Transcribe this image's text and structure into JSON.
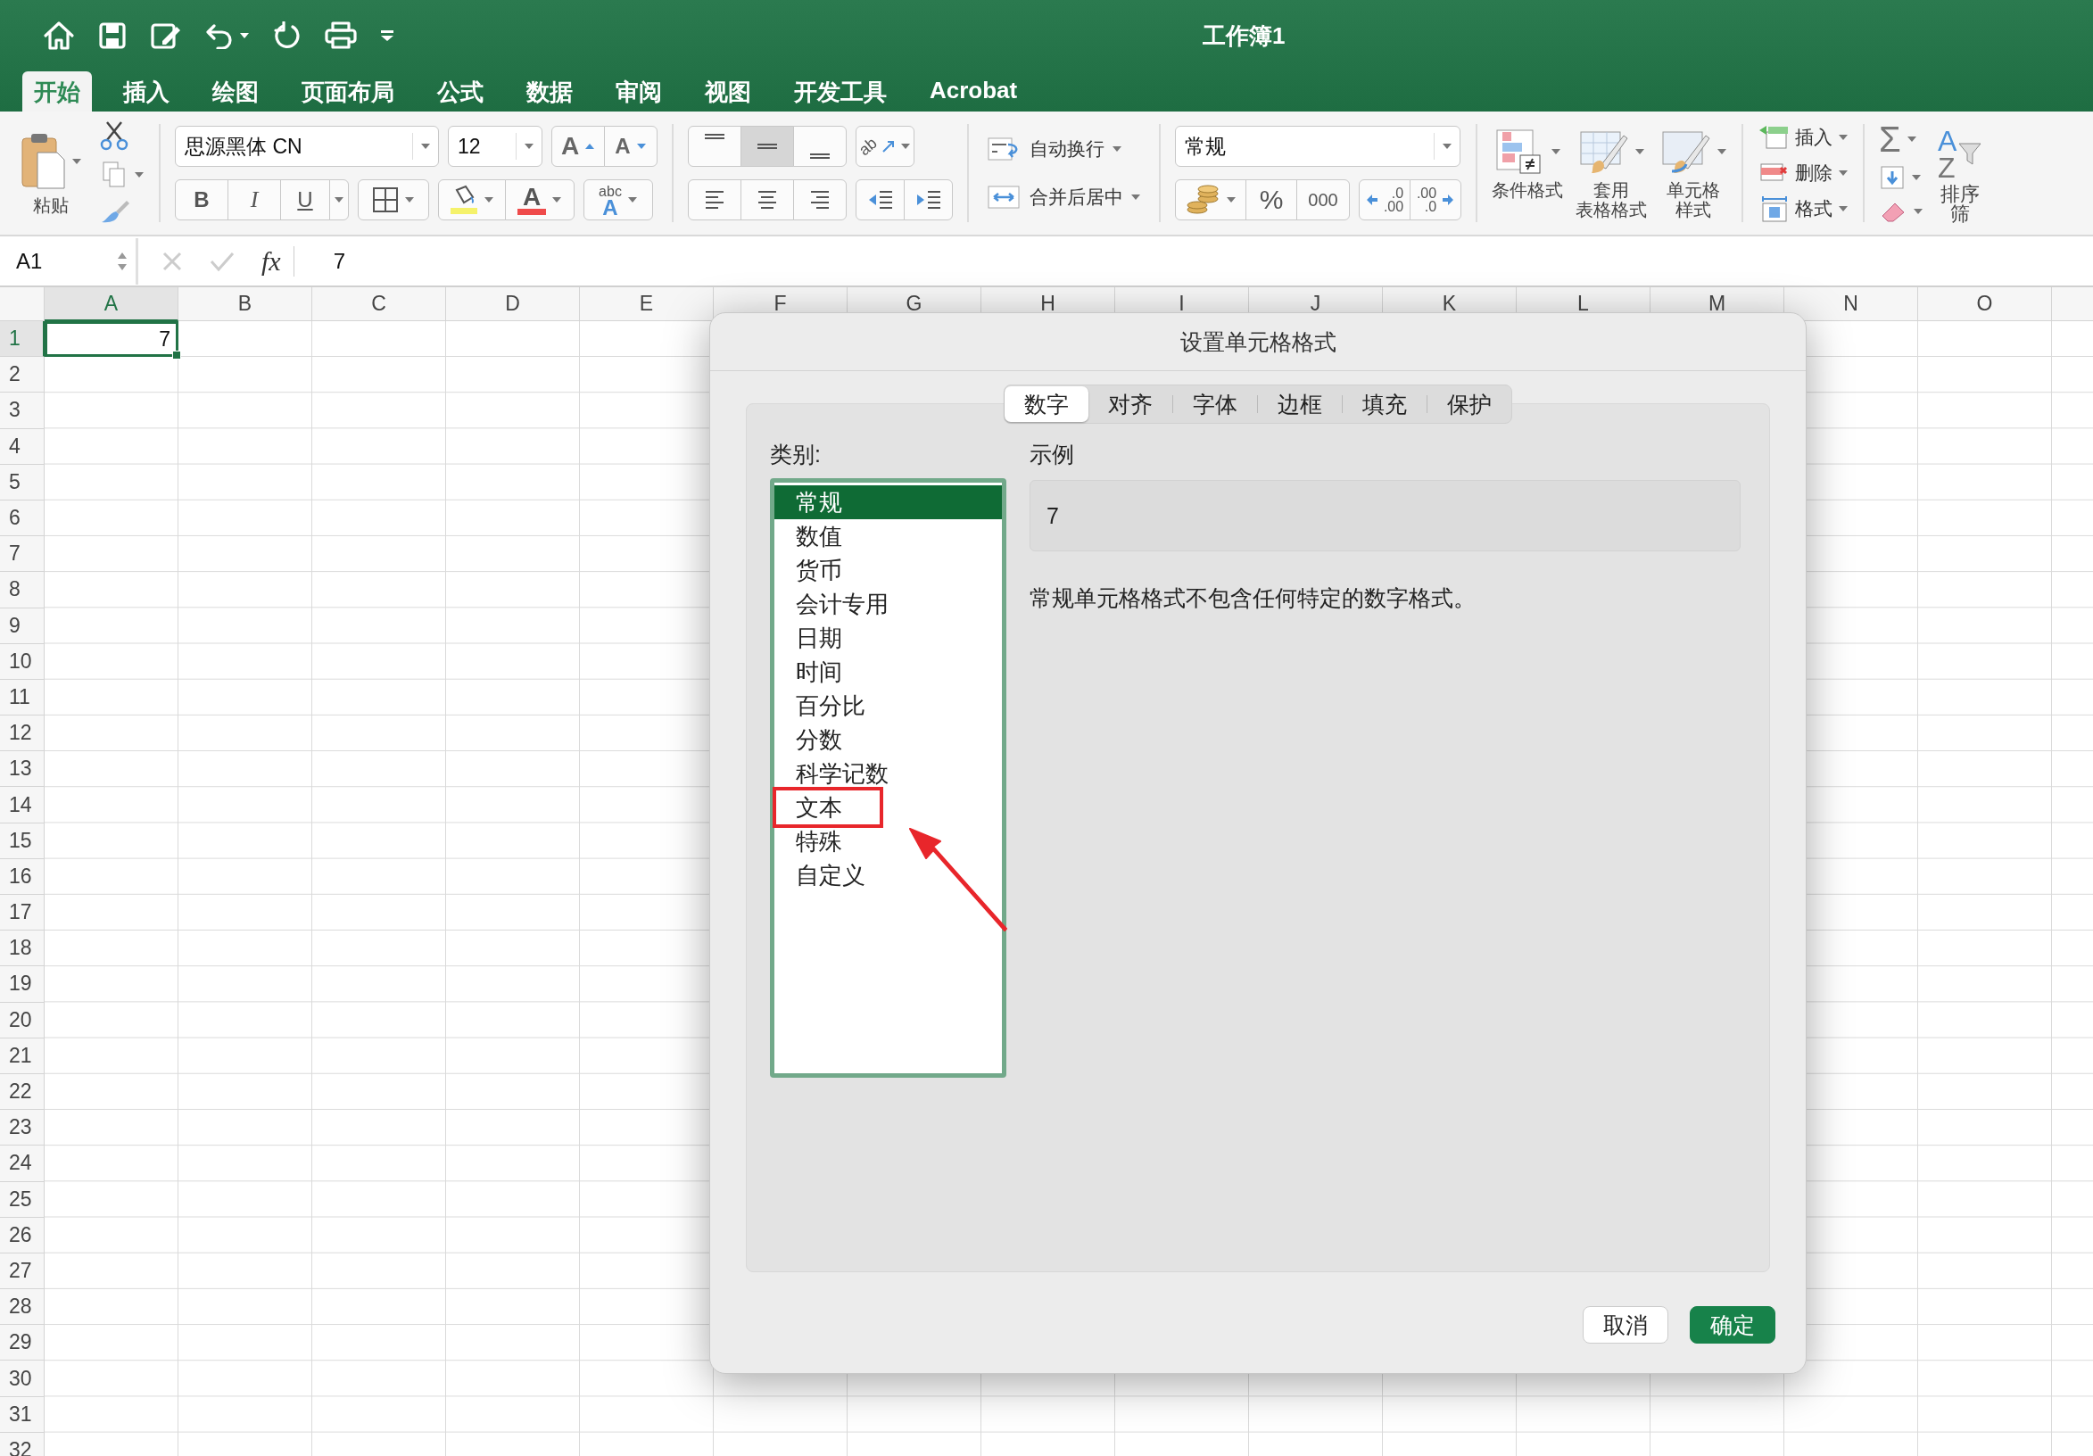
{
  "window": {
    "title": "工作簿1"
  },
  "ribbon_tabs": [
    {
      "label": "开始",
      "selected": true
    },
    {
      "label": "插入",
      "selected": false
    },
    {
      "label": "绘图",
      "selected": false
    },
    {
      "label": "页面布局",
      "selected": false
    },
    {
      "label": "公式",
      "selected": false
    },
    {
      "label": "数据",
      "selected": false
    },
    {
      "label": "审阅",
      "selected": false
    },
    {
      "label": "视图",
      "selected": false
    },
    {
      "label": "开发工具",
      "selected": false
    },
    {
      "label": "Acrobat",
      "selected": false
    }
  ],
  "ribbon": {
    "paste": "粘贴",
    "font_name": "思源黑体 CN",
    "font_size": "12",
    "grow_font": "A",
    "shrink_font": "A",
    "bold": "B",
    "italic": "I",
    "underline": "U",
    "font_color": "A",
    "phonetic": [
      "abc",
      "A"
    ],
    "vertical_alignment": [
      {
        "selected": false
      },
      {
        "selected": true
      },
      {
        "selected": false
      }
    ],
    "orientation": "ab",
    "wrap_text": "自动换行",
    "merge_center": "合并后居中",
    "number_format": "常规",
    "percent": "%",
    "thousands": "000",
    "decimal_increase": [
      ".0",
      ".00"
    ],
    "decimal_decrease": [
      ".00",
      ".0"
    ],
    "styles": [
      {
        "lines": [
          "条件格式"
        ]
      },
      {
        "lines": [
          "套用",
          "表格格式"
        ]
      },
      {
        "lines": [
          "单元格",
          "样式"
        ]
      }
    ],
    "cells": [
      "插入",
      "删除",
      "格式"
    ],
    "autosum": "Σ",
    "sort_letters": [
      "A",
      "Z"
    ],
    "sort_filter": [
      "排序",
      "筛"
    ]
  },
  "formula_bar": {
    "name_box": "A1",
    "fx": "fx",
    "value": "7"
  },
  "sheet": {
    "columns": [
      "A",
      "B",
      "C",
      "D",
      "E",
      "F",
      "G",
      "H",
      "I",
      "J",
      "K",
      "L",
      "M",
      "N",
      "O"
    ],
    "rows": [
      {
        "header": "1",
        "cells": [
          {
            "value": "7",
            "selected": true
          }
        ]
      },
      {
        "header": "2"
      },
      {
        "header": "3"
      },
      {
        "header": "4"
      },
      {
        "header": "5"
      },
      {
        "header": "6"
      },
      {
        "header": "7"
      },
      {
        "header": "8"
      },
      {
        "header": "9"
      },
      {
        "header": "10"
      },
      {
        "header": "11"
      },
      {
        "header": "12"
      },
      {
        "header": "13"
      },
      {
        "header": "14"
      },
      {
        "header": "15"
      },
      {
        "header": "16"
      },
      {
        "header": "17"
      },
      {
        "header": "18"
      },
      {
        "header": "19"
      },
      {
        "header": "20"
      },
      {
        "header": "21"
      },
      {
        "header": "22"
      },
      {
        "header": "23"
      },
      {
        "header": "24"
      },
      {
        "header": "25"
      },
      {
        "header": "26"
      },
      {
        "header": "27"
      },
      {
        "header": "28"
      },
      {
        "header": "29"
      },
      {
        "header": "30"
      },
      {
        "header": "31"
      },
      {
        "header": "32"
      }
    ]
  },
  "dialog": {
    "title": "设置单元格格式",
    "tabs": [
      {
        "label": "数字",
        "selected": true
      },
      {
        "label": "对齐",
        "selected": false
      },
      {
        "label": "字体",
        "selected": false
      },
      {
        "label": "边框",
        "selected": false
      },
      {
        "label": "填充",
        "selected": false
      },
      {
        "label": "保护",
        "selected": false
      }
    ],
    "category_label": "类别:",
    "categories": [
      {
        "label": "常规",
        "selected": true,
        "highlighted": false
      },
      {
        "label": "数值",
        "selected": false,
        "highlighted": false
      },
      {
        "label": "货币",
        "selected": false,
        "highlighted": false
      },
      {
        "label": "会计专用",
        "selected": false,
        "highlighted": false
      },
      {
        "label": "日期",
        "selected": false,
        "highlighted": false
      },
      {
        "label": "时间",
        "selected": false,
        "highlighted": false
      },
      {
        "label": "百分比",
        "selected": false,
        "highlighted": false
      },
      {
        "label": "分数",
        "selected": false,
        "highlighted": false
      },
      {
        "label": "科学记数",
        "selected": false,
        "highlighted": false
      },
      {
        "label": "文本",
        "selected": false,
        "highlighted": true
      },
      {
        "label": "特殊",
        "selected": false,
        "highlighted": false
      },
      {
        "label": "自定义",
        "selected": false,
        "highlighted": false
      }
    ],
    "sample_label": "示例",
    "sample_value": "7",
    "description": "常规单元格格式不包含任何特定的数字格式。",
    "buttons": [
      {
        "label": "取消",
        "kind": "secondary"
      },
      {
        "label": "确定",
        "kind": "default"
      }
    ]
  }
}
